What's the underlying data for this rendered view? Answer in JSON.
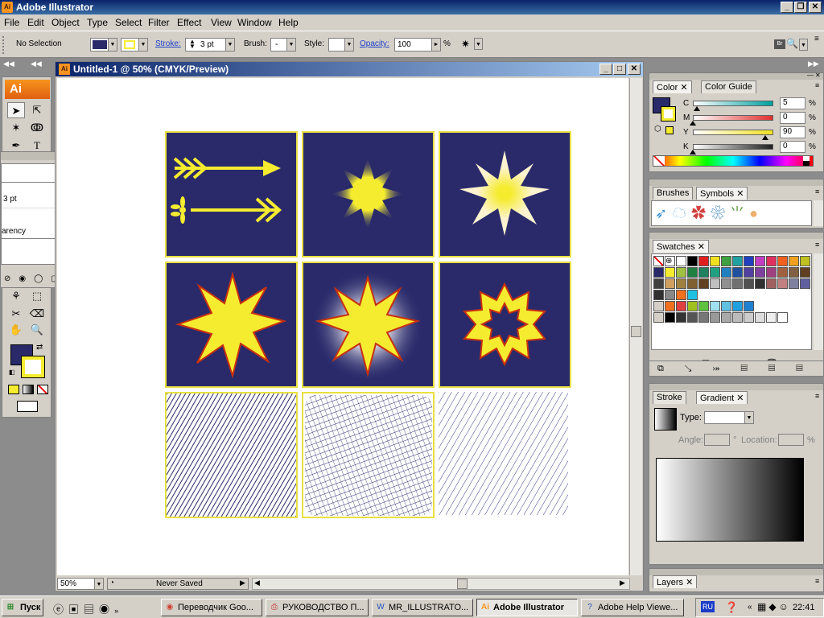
{
  "app": {
    "title": "Adobe Illustrator",
    "logo": "Ai"
  },
  "menu": [
    "File",
    "Edit",
    "Object",
    "Type",
    "Select",
    "Filter",
    "Effect",
    "View",
    "Window",
    "Help"
  ],
  "control": {
    "selection": "No Selection",
    "stroke_label": "Stroke:",
    "stroke_value": "3 pt",
    "brush_label": "Brush:",
    "style_label": "Style:",
    "opacity_label": "Opacity:",
    "opacity_value": "100",
    "percent": "%",
    "br_label": "Br"
  },
  "document": {
    "title": "Untitled-1 @ 50% (CMYK/Preview)",
    "zoom": "50%",
    "status": "Never Saved"
  },
  "float_panel": {
    "row1": "3 pt",
    "row2": "arency"
  },
  "color_panel": {
    "tabs": [
      "Color",
      "Color Guide"
    ],
    "channels": [
      {
        "label": "C",
        "value": "5",
        "percent": "%",
        "level": 0.05,
        "color": "#00a0a0"
      },
      {
        "label": "M",
        "value": "0",
        "percent": "%",
        "level": 0.0,
        "color": "#e03030"
      },
      {
        "label": "Y",
        "value": "90",
        "percent": "%",
        "level": 0.9,
        "color": "#f0e020"
      },
      {
        "label": "K",
        "value": "0",
        "percent": "%",
        "level": 0.0,
        "color": "#202020"
      }
    ],
    "fill_color": "#2a2a6b",
    "stroke_color": "#f5ec30"
  },
  "brushes_panel": {
    "tabs": [
      "Brushes",
      "Symbols"
    ]
  },
  "swatches_panel": {
    "tabs": [
      "Swatches"
    ]
  },
  "gradient_panel": {
    "tabs": [
      "Stroke",
      "Gradient"
    ],
    "type_label": "Type:",
    "angle_label": "Angle:",
    "degree": "°",
    "location_label": "Location:",
    "percent": "%"
  },
  "layers_panel": {
    "tabs": [
      "Layers"
    ]
  },
  "taskbar": {
    "start": "Пуск",
    "tasks": [
      {
        "label": "Переводчик Goo...",
        "icon": "chrome-icon"
      },
      {
        "label": "РУКОВОДСТВО П...",
        "icon": "pdf-icon"
      },
      {
        "label": "MR_ILLUSTRATO...",
        "icon": "word-icon"
      },
      {
        "label": "Adobe Illustrator",
        "icon": "illustrator-icon",
        "active": true
      },
      {
        "label": "Adobe Help Viewe...",
        "icon": "help-icon"
      }
    ],
    "lang": "RU",
    "clock": "22:41"
  }
}
